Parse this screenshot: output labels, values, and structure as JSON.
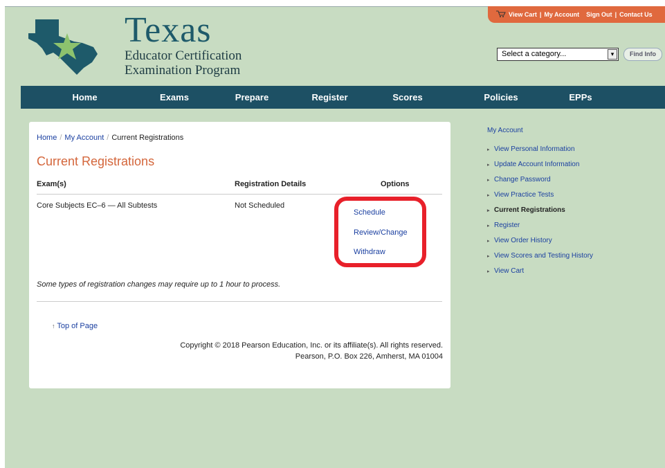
{
  "logo": {
    "title": "Texas",
    "subtitle_line1": "Educator Certification",
    "subtitle_line2": "Examination Program"
  },
  "utility": {
    "cart_icon": "cart-icon",
    "view_cart": "View Cart",
    "my_account": "My Account",
    "sign_out": "Sign Out",
    "contact_us": "Contact Us"
  },
  "category": {
    "selected": "Select a category...",
    "find_label": "Find Info"
  },
  "nav": [
    "Home",
    "Exams",
    "Prepare",
    "Register",
    "Scores",
    "Policies",
    "EPPs"
  ],
  "breadcrumb": {
    "home": "Home",
    "my_account": "My Account",
    "current": "Current Registrations"
  },
  "page_title": "Current Registrations",
  "table": {
    "headers": [
      "Exam(s)",
      "Registration Details",
      "Options"
    ],
    "rows": [
      {
        "exam": "Core Subjects EC–6 — All Subtests",
        "details": "Not Scheduled",
        "options": [
          "Schedule",
          "Review/Change",
          "Withdraw"
        ]
      }
    ]
  },
  "note": "Some types of registration changes may require up to 1 hour to process.",
  "top_of_page": "Top of Page",
  "copyright_line1": "Copyright © 2018 Pearson Education, Inc. or its affiliate(s). All rights reserved.",
  "copyright_line2": "Pearson, P.O. Box 226, Amherst, MA 01004",
  "sidebar": {
    "heading": "My Account",
    "items": [
      {
        "label": "View Personal Information",
        "current": false
      },
      {
        "label": "Update Account Information",
        "current": false
      },
      {
        "label": "Change Password",
        "current": false
      },
      {
        "label": "View Practice Tests",
        "current": false
      },
      {
        "label": "Current Registrations",
        "current": true
      },
      {
        "label": "Register",
        "current": false
      },
      {
        "label": "View Order History",
        "current": false
      },
      {
        "label": "View Scores and Testing History",
        "current": false
      },
      {
        "label": "View Cart",
        "current": false
      }
    ]
  },
  "colors": {
    "background": "#c8dcc2",
    "nav": "#1d5064",
    "accent": "#e0693e",
    "link": "#1a3fa0",
    "highlight": "#e8202a"
  }
}
